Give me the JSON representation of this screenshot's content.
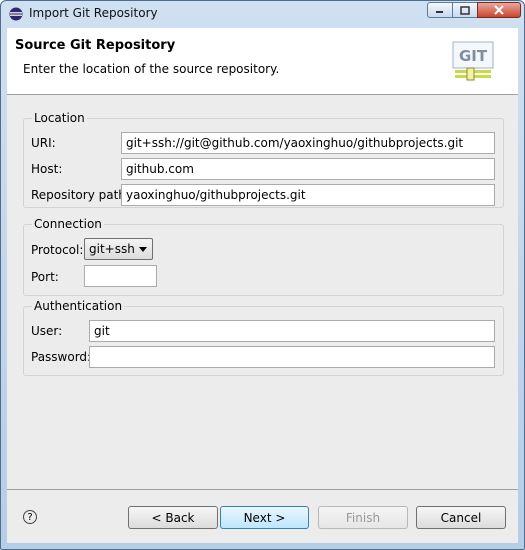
{
  "window": {
    "title": "Import Git Repository"
  },
  "header": {
    "title": "Source Git Repository",
    "description": "Enter the location of the source repository.",
    "logo_text": "GIT"
  },
  "location": {
    "label": "Location",
    "uri_label": "URI:",
    "uri_value": "git+ssh://git@github.com/yaoxinghuo/githubprojects.git",
    "host_label": "Host:",
    "host_value": "github.com",
    "path_label": "Repository path:",
    "path_value": "yaoxinghuo/githubprojects.git"
  },
  "connection": {
    "label": "Connection",
    "protocol_label": "Protocol:",
    "protocol_value": "git+ssh",
    "port_label": "Port:",
    "port_value": ""
  },
  "authentication": {
    "label": "Authentication",
    "user_label": "User:",
    "user_value": "git",
    "password_label": "Password:",
    "password_value": ""
  },
  "buttons": {
    "help": "?",
    "back": "< Back",
    "next": "Next >",
    "finish": "Finish",
    "cancel": "Cancel"
  }
}
